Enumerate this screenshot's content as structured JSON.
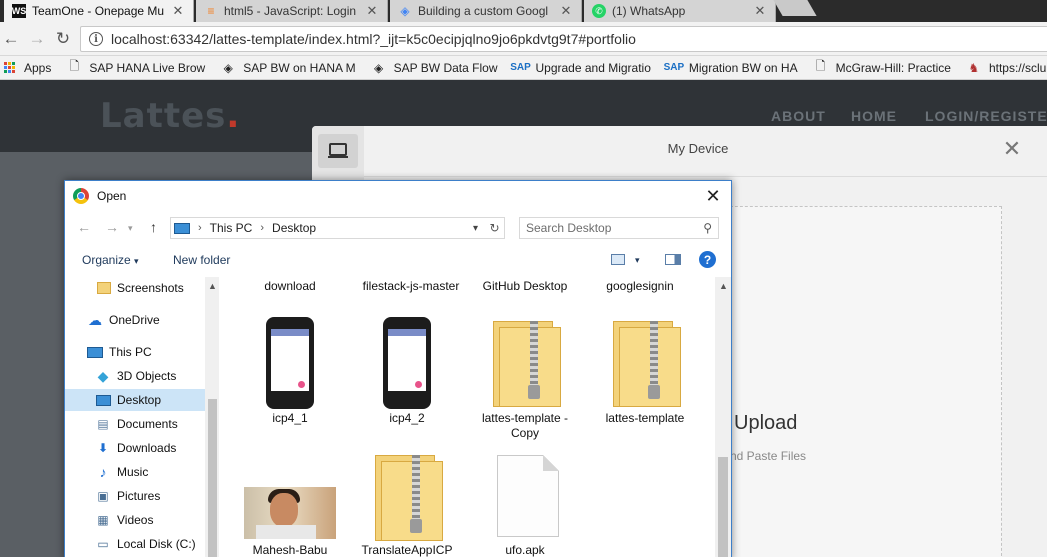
{
  "browser": {
    "tabs": [
      {
        "label": "TeamOne - Onepage Mu",
        "active": true,
        "favicon": "webstorm-icon"
      },
      {
        "label": "html5 - JavaScript: Login",
        "active": false,
        "favicon": "stackoverflow-icon"
      },
      {
        "label": "Building a custom Googl",
        "active": false,
        "favicon": "google-dev-icon"
      },
      {
        "label": "(1) WhatsApp",
        "active": false,
        "favicon": "whatsapp-icon"
      }
    ],
    "url": "localhost:63342/lattes-template/index.html?_ijt=k5c0ecipjqlno9jo6pkdvtg9t7#portfolio",
    "bookmarks": [
      {
        "label": "Apps",
        "icon": "apps-grid-icon"
      },
      {
        "label": "SAP HANA Live Brow",
        "icon": "page-icon"
      },
      {
        "label": "SAP BW on HANA M",
        "icon": "diamond-icon"
      },
      {
        "label": "SAP BW Data Flow",
        "icon": "diamond-icon"
      },
      {
        "label": "Upgrade and Migratio",
        "icon": "sap-icon"
      },
      {
        "label": "Migration BW on HA",
        "icon": "sap-icon"
      },
      {
        "label": "McGraw-Hill: Practice",
        "icon": "page-icon"
      },
      {
        "label": "https://sclubev",
        "icon": "person-icon"
      }
    ]
  },
  "site": {
    "logo": "Lattes",
    "logo_dot": ".",
    "nav": [
      "ABOUT",
      "HOME",
      "LOGIN/REGISTER"
    ]
  },
  "picker": {
    "title": "My Device",
    "upload_heading": "Upload",
    "paste_hint": "nd Paste Files"
  },
  "dialog": {
    "title": "Open",
    "path": [
      "This PC",
      "Desktop"
    ],
    "search_placeholder": "Search Desktop",
    "organize": "Organize",
    "new_folder": "New folder",
    "nav_items": [
      {
        "label": "Screenshots",
        "icon": "folder-icon",
        "indent": 2
      },
      {
        "label": "OneDrive",
        "icon": "onedrive-icon",
        "indent": 1
      },
      {
        "label": "This PC",
        "icon": "pc-icon",
        "indent": 1
      },
      {
        "label": "3D Objects",
        "icon": "cube-icon",
        "indent": 2
      },
      {
        "label": "Desktop",
        "icon": "desktop-icon",
        "indent": 2,
        "selected": true
      },
      {
        "label": "Documents",
        "icon": "documents-icon",
        "indent": 2
      },
      {
        "label": "Downloads",
        "icon": "download-icon",
        "indent": 2
      },
      {
        "label": "Music",
        "icon": "music-icon",
        "indent": 2
      },
      {
        "label": "Pictures",
        "icon": "pictures-icon",
        "indent": 2
      },
      {
        "label": "Videos",
        "icon": "videos-icon",
        "indent": 2
      },
      {
        "label": "Local Disk (C:)",
        "icon": "disk-icon",
        "indent": 2
      }
    ],
    "files": [
      {
        "name": "download",
        "kind": "cut"
      },
      {
        "name": "filestack-js-master",
        "kind": "cut"
      },
      {
        "name": "GitHub Desktop",
        "kind": "cut"
      },
      {
        "name": "googlesignin",
        "kind": "cut"
      },
      {
        "name": "icp4_1",
        "kind": "phone"
      },
      {
        "name": "icp4_2",
        "kind": "phone"
      },
      {
        "name": "lattes-template - Copy",
        "kind": "zip"
      },
      {
        "name": "lattes-template",
        "kind": "zip"
      },
      {
        "name": "Mahesh-Babu",
        "kind": "photo"
      },
      {
        "name": "TranslateAppICP",
        "kind": "zip"
      },
      {
        "name": "ufo.apk",
        "kind": "doc"
      }
    ]
  }
}
